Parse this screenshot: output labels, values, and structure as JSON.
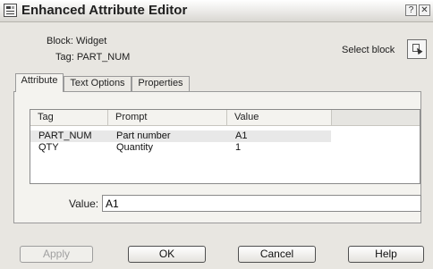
{
  "window": {
    "title": "Enhanced Attribute Editor"
  },
  "titlebar": {
    "help_glyph": "?",
    "close_glyph": "✕"
  },
  "header": {
    "block_label": "Block: Widget",
    "tag_label": "Tag: PART_NUM",
    "select_block_label": "Select block"
  },
  "tabs": [
    {
      "label": "Attribute",
      "active": true
    },
    {
      "label": "Text Options",
      "active": false
    },
    {
      "label": "Properties",
      "active": false
    }
  ],
  "attribute_table": {
    "columns": [
      "Tag",
      "Prompt",
      "Value"
    ],
    "rows": [
      {
        "tag": "PART_NUM",
        "prompt": "Part number",
        "value": "A1",
        "selected": true
      },
      {
        "tag": "QTY",
        "prompt": "Quantity",
        "value": "1",
        "selected": false
      }
    ]
  },
  "value_field": {
    "label": "Value:",
    "value": "A1"
  },
  "buttons": {
    "apply": {
      "label": "Apply",
      "enabled": false
    },
    "ok": "OK",
    "cancel": "Cancel",
    "help": "Help"
  },
  "icons": {
    "app": "attribute-editor-icon",
    "select_block": "select-object-icon"
  }
}
